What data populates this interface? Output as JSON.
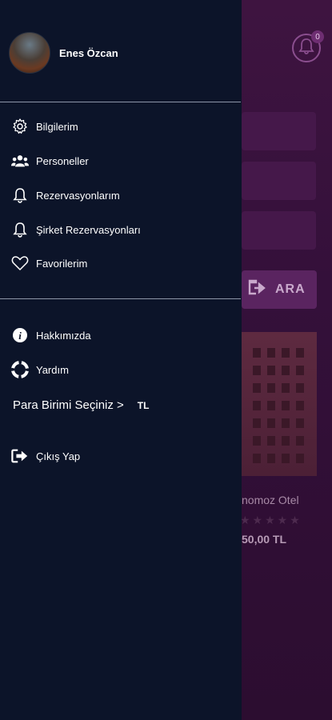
{
  "background": {
    "notification_count": "0",
    "search_button_label": "ARA",
    "hotel_name": "nomoz Otel",
    "hotel_price": "50,00 TL",
    "stars": "★★★★★"
  },
  "profile": {
    "name": "Enes Özcan"
  },
  "menu": {
    "items": [
      {
        "label": "Bilgilerim",
        "icon": "gear-icon"
      },
      {
        "label": "Personeller",
        "icon": "people-icon"
      },
      {
        "label": "Rezervasyonlarım",
        "icon": "bell-icon"
      },
      {
        "label": "Şirket Rezervasyonları",
        "icon": "bell-icon"
      },
      {
        "label": "Favorilerim",
        "icon": "heart-icon"
      }
    ],
    "secondary": [
      {
        "label": "Hakkımızda",
        "icon": "info-icon"
      },
      {
        "label": "Yardım",
        "icon": "lifebuoy-icon"
      }
    ],
    "currency_label": "Para Birimi Seçiniz >",
    "currency_value": "TL",
    "logout_label": "Çıkış Yap"
  },
  "colors": {
    "drawer_bg": "#0c1429",
    "app_bg": "#3a1238",
    "text": "#ffffff"
  }
}
